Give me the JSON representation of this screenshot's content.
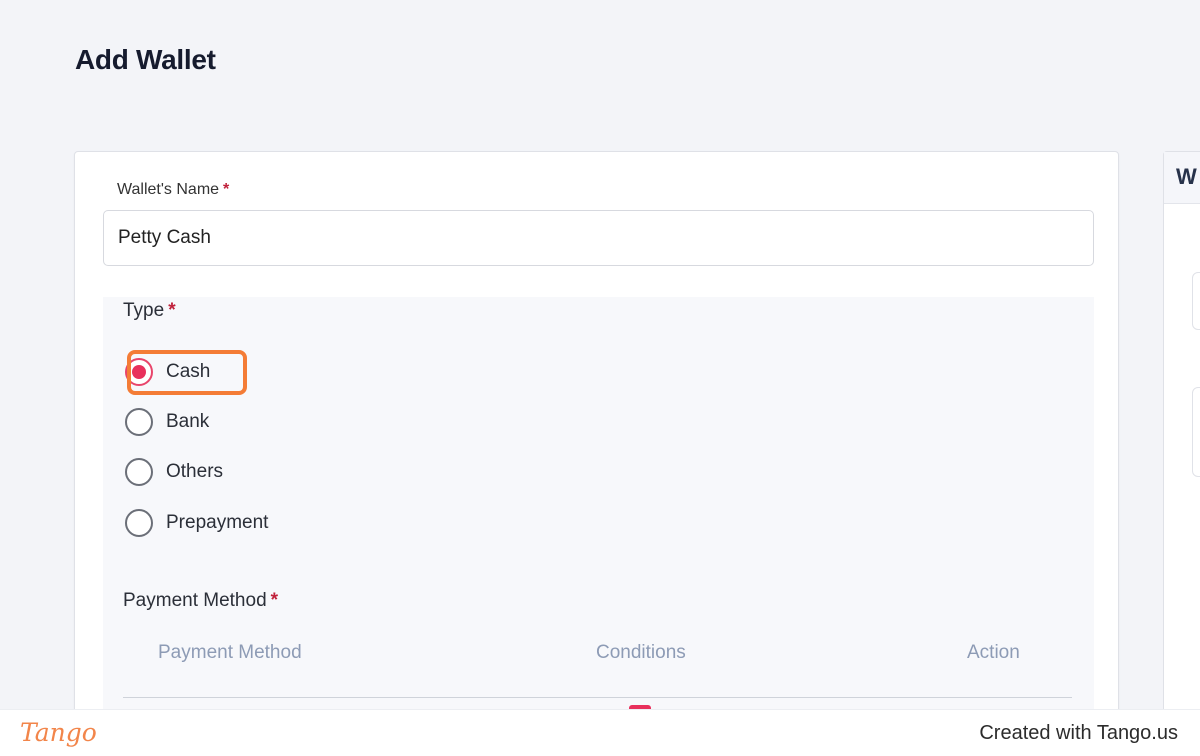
{
  "page": {
    "title": "Add Wallet"
  },
  "form": {
    "wallet_name_label": "Wallet's Name",
    "wallet_name_value": "Petty Cash",
    "required_mark": "*",
    "type_label": "Type",
    "type_options": [
      {
        "label": "Cash",
        "checked": true
      },
      {
        "label": "Bank",
        "checked": false
      },
      {
        "label": "Others",
        "checked": false
      },
      {
        "label": "Prepayment",
        "checked": false
      }
    ],
    "payment_method_label": "Payment Method",
    "table_headers": [
      "Payment Method",
      "Conditions",
      "Action"
    ]
  },
  "side_panel": {
    "header_text": "W"
  },
  "footer": {
    "logo_text": "Tango",
    "credit_text": "Created with Tango.us"
  },
  "colors": {
    "accent": "#e8305c",
    "highlight": "#f47c36",
    "table_header": "#8d9bb5"
  }
}
